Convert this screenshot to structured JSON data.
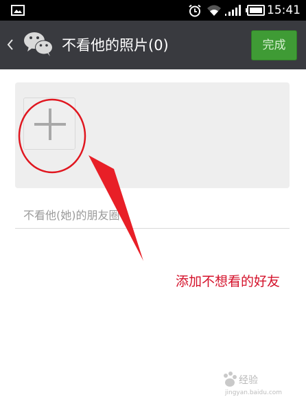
{
  "status_bar": {
    "time": "15:41",
    "icons": [
      "gallery-icon",
      "alarm-icon",
      "wifi-icon",
      "signal-icon",
      "battery-icon"
    ]
  },
  "header": {
    "title": "不看他的照片(0)",
    "done_label": "完成",
    "back_icon": "chevron-left-icon",
    "app_icon": "wechat-icon"
  },
  "picker": {
    "add_icon": "plus-icon"
  },
  "hint_field": {
    "text": "不看他(她)的朋友圈"
  },
  "annotation": {
    "text": "添加不想看的好友",
    "color": "#d4112a"
  },
  "watermark": {
    "text": "经验",
    "url": "jingyan.baidu.com"
  },
  "colors": {
    "title_bar": "#393a3f",
    "done_button": "#3f9b35",
    "panel": "#eeeeee"
  }
}
